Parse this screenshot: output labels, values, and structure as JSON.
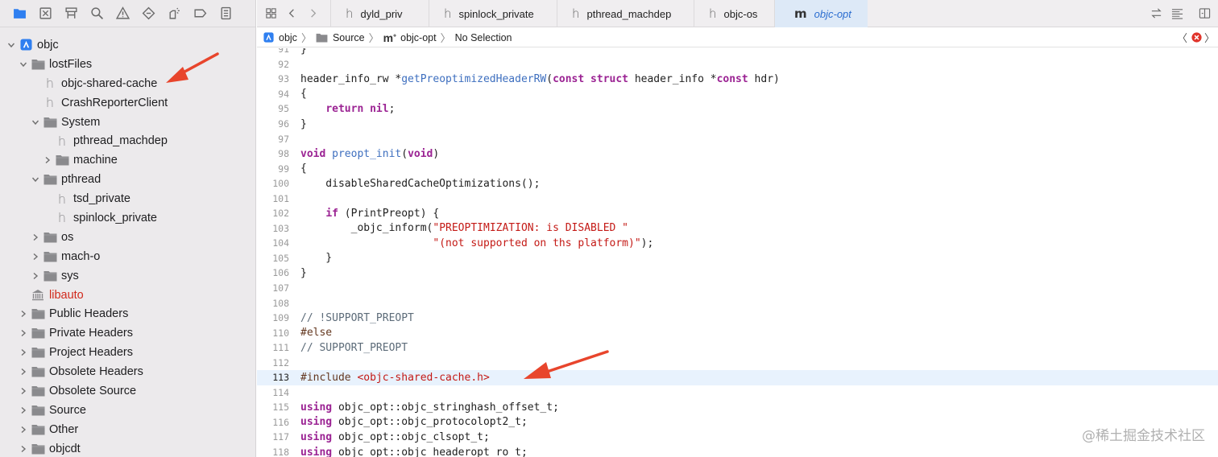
{
  "sidebar": {
    "tree": [
      {
        "label": "objc",
        "indent": 0,
        "disc": "open",
        "icon": "project"
      },
      {
        "label": "lostFiles",
        "indent": 1,
        "disc": "open",
        "icon": "folder"
      },
      {
        "label": "objc-shared-cache",
        "indent": 2,
        "disc": "none",
        "icon": "header"
      },
      {
        "label": "CrashReporterClient",
        "indent": 2,
        "disc": "none",
        "icon": "header"
      },
      {
        "label": "System",
        "indent": 2,
        "disc": "open",
        "icon": "folder"
      },
      {
        "label": "pthread_machdep",
        "indent": 3,
        "disc": "none",
        "icon": "header"
      },
      {
        "label": "machine",
        "indent": 3,
        "disc": "closed",
        "icon": "folder"
      },
      {
        "label": "pthread",
        "indent": 2,
        "disc": "open",
        "icon": "folder"
      },
      {
        "label": "tsd_private",
        "indent": 3,
        "disc": "none",
        "icon": "header"
      },
      {
        "label": "spinlock_private",
        "indent": 3,
        "disc": "none",
        "icon": "header"
      },
      {
        "label": "os",
        "indent": 2,
        "disc": "closed",
        "icon": "folder"
      },
      {
        "label": "mach-o",
        "indent": 2,
        "disc": "closed",
        "icon": "folder"
      },
      {
        "label": "sys",
        "indent": 2,
        "disc": "closed",
        "icon": "folder"
      },
      {
        "label": "libauto",
        "indent": 1,
        "disc": "none",
        "icon": "library",
        "red": true
      },
      {
        "label": "Public Headers",
        "indent": 1,
        "disc": "closed",
        "icon": "folder"
      },
      {
        "label": "Private Headers",
        "indent": 1,
        "disc": "closed",
        "icon": "folder"
      },
      {
        "label": "Project Headers",
        "indent": 1,
        "disc": "closed",
        "icon": "folder"
      },
      {
        "label": "Obsolete Headers",
        "indent": 1,
        "disc": "closed",
        "icon": "folder"
      },
      {
        "label": "Obsolete Source",
        "indent": 1,
        "disc": "closed",
        "icon": "folder"
      },
      {
        "label": "Source",
        "indent": 1,
        "disc": "closed",
        "icon": "folder"
      },
      {
        "label": "Other",
        "indent": 1,
        "disc": "closed",
        "icon": "folder"
      },
      {
        "label": "objcdt",
        "indent": 1,
        "disc": "closed",
        "icon": "folder"
      }
    ]
  },
  "tabs": [
    {
      "label": "dyld_priv",
      "glyph": "h",
      "active": false
    },
    {
      "label": "spinlock_private",
      "glyph": "h",
      "active": false
    },
    {
      "label": "pthread_machdep",
      "glyph": "h",
      "active": false
    },
    {
      "label": "objc-os",
      "glyph": "h",
      "active": false
    },
    {
      "label": "objc-opt",
      "glyph": "m",
      "active": true
    }
  ],
  "jumpbar": {
    "project": "objc",
    "folder": "Source",
    "file": "objc-opt",
    "selection": "No Selection"
  },
  "code": [
    {
      "n": "91",
      "t": [
        [
          "",
          "}"
        ]
      ]
    },
    {
      "n": "92",
      "t": []
    },
    {
      "n": "93",
      "t": [
        [
          "",
          "header_info_rw *"
        ],
        [
          "fn",
          "getPreoptimizedHeaderRW"
        ],
        [
          "",
          "("
        ],
        [
          "kw",
          "const struct"
        ],
        [
          "",
          " header_info *"
        ],
        [
          "kw",
          "const"
        ],
        [
          "",
          " hdr)"
        ]
      ]
    },
    {
      "n": "94",
      "t": [
        [
          "",
          "{"
        ]
      ]
    },
    {
      "n": "95",
      "t": [
        [
          "",
          "    "
        ],
        [
          "kw",
          "return nil"
        ],
        [
          "",
          ";"
        ]
      ]
    },
    {
      "n": "96",
      "t": [
        [
          "",
          "}"
        ]
      ]
    },
    {
      "n": "97",
      "t": []
    },
    {
      "n": "98",
      "t": [
        [
          "kw",
          "void"
        ],
        [
          "",
          " "
        ],
        [
          "fn",
          "preopt_init"
        ],
        [
          "",
          "("
        ],
        [
          "kw",
          "void"
        ],
        [
          "",
          ")"
        ]
      ]
    },
    {
      "n": "99",
      "t": [
        [
          "",
          "{"
        ]
      ]
    },
    {
      "n": "100",
      "t": [
        [
          "",
          "    disableSharedCacheOptimizations();"
        ]
      ]
    },
    {
      "n": "101",
      "t": []
    },
    {
      "n": "102",
      "t": [
        [
          "",
          "    "
        ],
        [
          "kw",
          "if"
        ],
        [
          "",
          " (PrintPreopt) {"
        ]
      ]
    },
    {
      "n": "103",
      "t": [
        [
          "",
          "        _objc_inform("
        ],
        [
          "str",
          "\"PREOPTIMIZATION: is DISABLED \""
        ]
      ]
    },
    {
      "n": "104",
      "t": [
        [
          "",
          "                     "
        ],
        [
          "str",
          "\"(not supported on ths platform)\""
        ],
        [
          "",
          ");"
        ]
      ]
    },
    {
      "n": "105",
      "t": [
        [
          "",
          "    }"
        ]
      ]
    },
    {
      "n": "106",
      "t": [
        [
          "",
          "}"
        ]
      ]
    },
    {
      "n": "107",
      "t": []
    },
    {
      "n": "108",
      "t": []
    },
    {
      "n": "109",
      "t": [
        [
          "cmt",
          "// !SUPPORT_PREOPT"
        ]
      ]
    },
    {
      "n": "110",
      "t": [
        [
          "pp",
          "#else"
        ]
      ]
    },
    {
      "n": "111",
      "t": [
        [
          "cmt",
          "// SUPPORT_PREOPT"
        ]
      ]
    },
    {
      "n": "112",
      "t": []
    },
    {
      "n": "113",
      "t": [
        [
          "pp",
          "#include "
        ],
        [
          "str",
          "<objc-shared-cache.h>"
        ]
      ],
      "hl": true
    },
    {
      "n": "114",
      "t": []
    },
    {
      "n": "115",
      "t": [
        [
          "kw",
          "using"
        ],
        [
          "",
          " objc_opt::objc_stringhash_offset_t;"
        ]
      ]
    },
    {
      "n": "116",
      "t": [
        [
          "kw",
          "using"
        ],
        [
          "",
          " objc_opt::objc_protocolopt2_t;"
        ]
      ]
    },
    {
      "n": "117",
      "t": [
        [
          "kw",
          "using"
        ],
        [
          "",
          " objc_opt::objc_clsopt_t;"
        ]
      ]
    },
    {
      "n": "118",
      "t": [
        [
          "kw",
          "using"
        ],
        [
          "",
          " objc_opt::objc_headeropt_ro_t;"
        ]
      ]
    }
  ],
  "watermark": "@稀土掘金技术社区",
  "colors": {
    "arrow": "#e8452c",
    "active_tab": "#dde9f7",
    "keyword": "#9b2393",
    "string": "#c41a16"
  }
}
